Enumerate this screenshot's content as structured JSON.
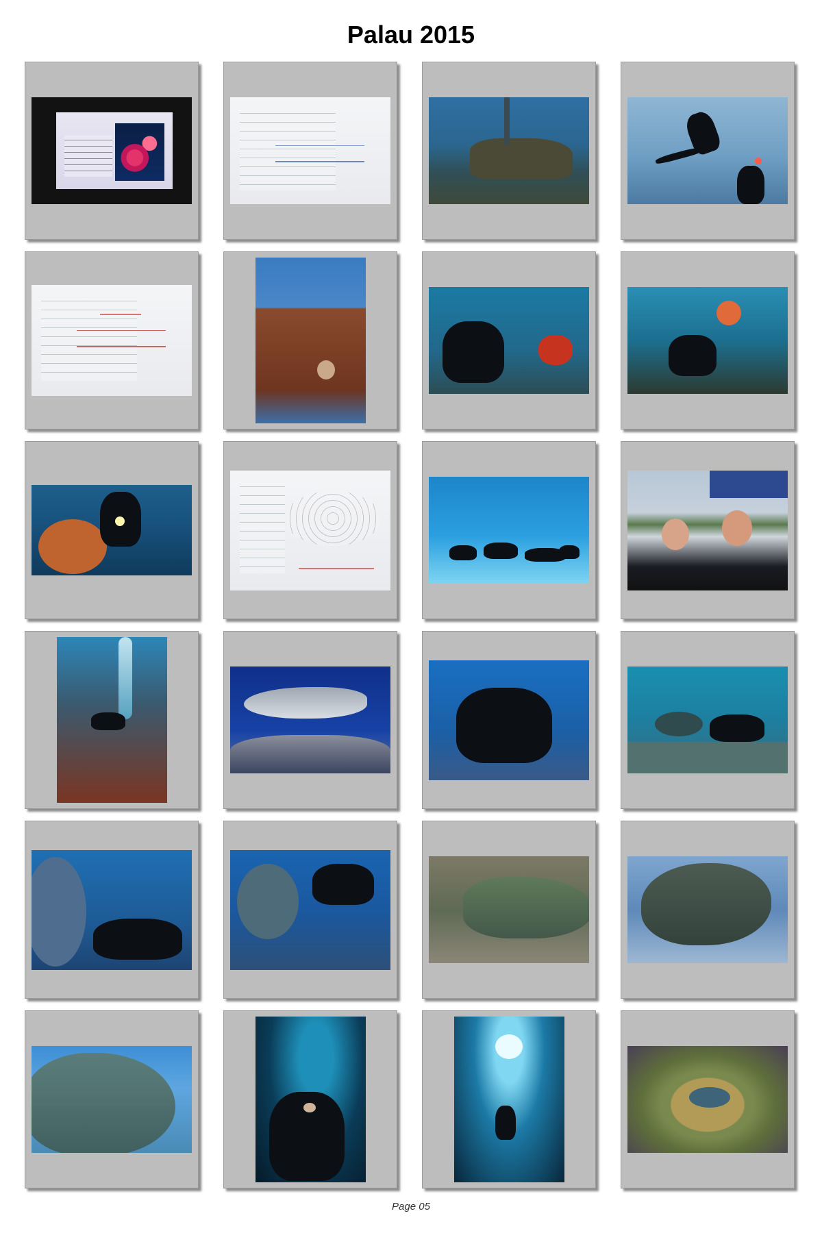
{
  "page": {
    "title": "Palau 2015",
    "footer": "Page 05"
  },
  "photos": [
    {
      "subject": "crew-slide"
    },
    {
      "subject": "whiteboard-monday"
    },
    {
      "subject": "wreck-reef"
    },
    {
      "subject": "diver-silhouette"
    },
    {
      "subject": "whiteboard-monday-2"
    },
    {
      "subject": "coral-tower"
    },
    {
      "subject": "diver-with-camera"
    },
    {
      "subject": "diver-and-sponge"
    },
    {
      "subject": "diver-with-torch"
    },
    {
      "subject": "whiteboard-german-channel"
    },
    {
      "subject": "group-of-divers"
    },
    {
      "subject": "couple-on-boat"
    },
    {
      "subject": "diver-on-reef-wall"
    },
    {
      "subject": "whitetip-shark"
    },
    {
      "subject": "diver-waving"
    },
    {
      "subject": "diver-with-wrasse"
    },
    {
      "subject": "napoleon-wrasse-1"
    },
    {
      "subject": "napoleon-wrasse-2"
    },
    {
      "subject": "napoleon-wrasse-3"
    },
    {
      "subject": "napoleon-wrasse-4"
    },
    {
      "subject": "napoleon-wrasse-closeup"
    },
    {
      "subject": "diver-in-cave"
    },
    {
      "subject": "blue-hole-diver"
    },
    {
      "subject": "fish-on-coral-plate"
    }
  ]
}
